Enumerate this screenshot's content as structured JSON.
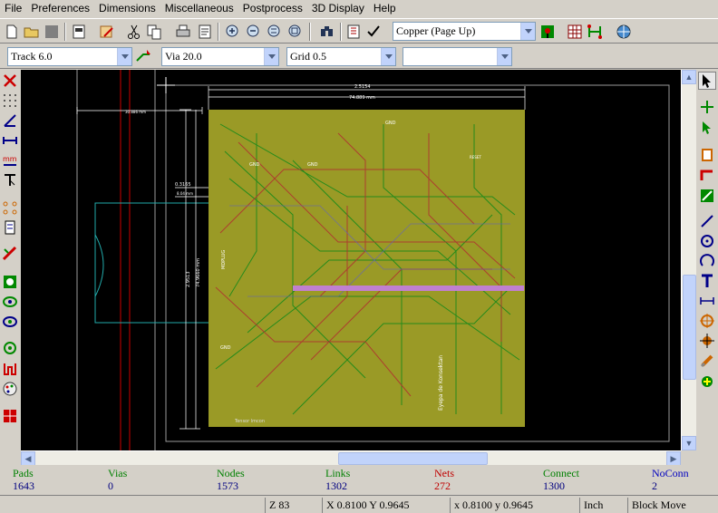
{
  "menu": [
    "File",
    "Preferences",
    "Dimensions",
    "Miscellaneous",
    "Postprocess",
    "3D Display",
    "Help"
  ],
  "layer_select": {
    "value": "Copper (Page Up)"
  },
  "track_select": {
    "value": "Track 6.0"
  },
  "via_select": {
    "value": "Via 20.0"
  },
  "grid_select": {
    "value": "Grid 0.5"
  },
  "zoom_select": {
    "value": ""
  },
  "board": {
    "dim_width_label": "2.5154",
    "dim_width_mm": "74.889 mm",
    "dim_top_left": "30.886 mm",
    "dim_left_vertical": "2.9513",
    "dim_left_vertical_mm": "74.9660 mm",
    "dim_small": "0.3165",
    "dim_small_mm": "8.04 mm",
    "text_gnd": "GND",
    "text_reset": "RESET",
    "text_mdplug": "MDPLUG",
    "text_eyepa": "Eyepa de Konsektan",
    "text_tensor": "Tensor lmcon"
  },
  "info": {
    "pads": {
      "label": "Pads",
      "value": "1643"
    },
    "vias": {
      "label": "Vias",
      "value": "0"
    },
    "nodes": {
      "label": "Nodes",
      "value": "1573"
    },
    "links": {
      "label": "Links",
      "value": "1302"
    },
    "nets": {
      "label": "Nets",
      "value": "272"
    },
    "connect": {
      "label": "Connect",
      "value": "1300"
    },
    "noconn": {
      "label": "NoConn",
      "value": "2"
    }
  },
  "status": {
    "zoom": "Z 83",
    "abs_coords": "X 0.8100  Y 0.9645",
    "rel_coords": "x 0.8100  y 0.9645",
    "units": "Inch",
    "mode": "Block Move"
  },
  "colors": {
    "info_label": "#008000",
    "info_value": "#000080",
    "nets": "#c00000",
    "noconn": "#0000c0",
    "pcb_bg": "#9a9a26",
    "canvas": "#000000"
  }
}
